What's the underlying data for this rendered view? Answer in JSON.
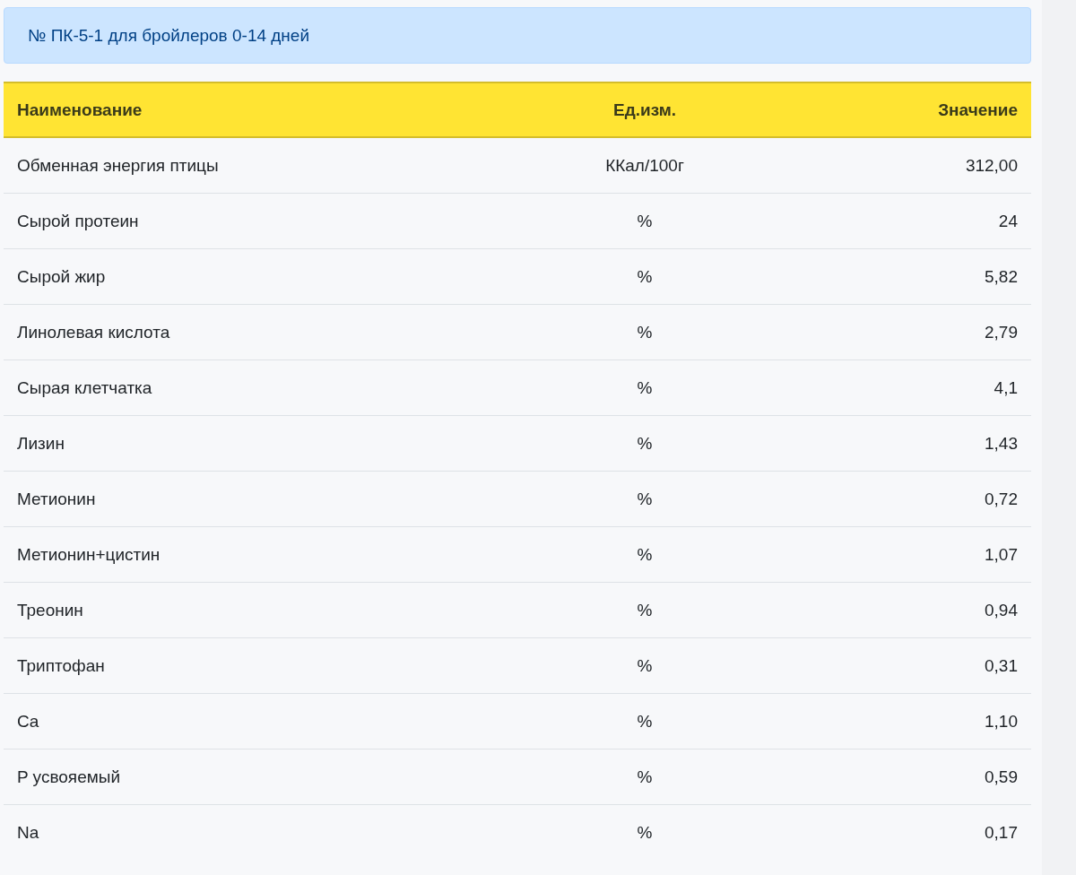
{
  "title": "№ ПК-5-1 для бройлеров 0-14 дней",
  "table": {
    "columns": [
      "Наименование",
      "Ед.изм.",
      "Значение"
    ],
    "rows": [
      [
        "Обменная энергия птицы",
        "ККал/100г",
        "312,00"
      ],
      [
        "Сырой протеин",
        "%",
        "24"
      ],
      [
        "Сырой жир",
        "%",
        "5,82"
      ],
      [
        "Линолевая кислота",
        "%",
        "2,79"
      ],
      [
        "Сырая клетчатка",
        "%",
        "4,1"
      ],
      [
        "Лизин",
        "%",
        "1,43"
      ],
      [
        "Метионин",
        "%",
        "0,72"
      ],
      [
        "Метионин+цистин",
        "%",
        "1,07"
      ],
      [
        "Треонин",
        "%",
        "0,94"
      ],
      [
        "Триптофан",
        "%",
        "0,31"
      ],
      [
        "Ca",
        "%",
        "1,10"
      ],
      [
        "P усвояемый",
        "%",
        "0,59"
      ],
      [
        "Na",
        "%",
        "0,17"
      ]
    ]
  }
}
